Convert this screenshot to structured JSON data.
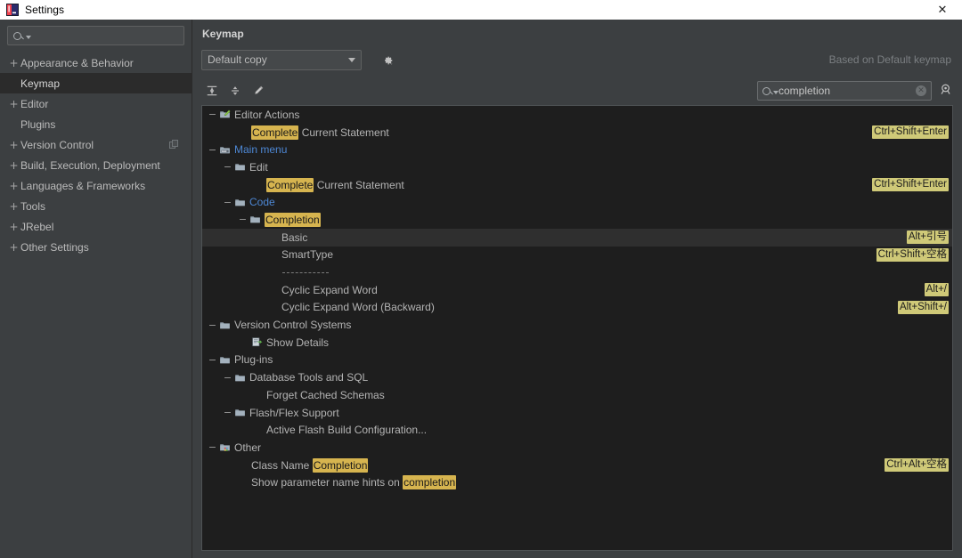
{
  "window": {
    "title": "Settings",
    "icon": "intellij-idea-icon",
    "close_label": "✕"
  },
  "sidebar": {
    "search": {
      "placeholder": "",
      "value": "",
      "icon": "search-icon"
    },
    "items": [
      {
        "label": "Appearance & Behavior",
        "expander": "+",
        "selected": false,
        "trailing_icon": ""
      },
      {
        "label": "Keymap",
        "expander": "",
        "selected": true,
        "trailing_icon": ""
      },
      {
        "label": "Editor",
        "expander": "+",
        "selected": false,
        "trailing_icon": ""
      },
      {
        "label": "Plugins",
        "expander": "",
        "selected": false,
        "trailing_icon": ""
      },
      {
        "label": "Version Control",
        "expander": "+",
        "selected": false,
        "trailing_icon": "copy-icon"
      },
      {
        "label": "Build, Execution, Deployment",
        "expander": "+",
        "selected": false,
        "trailing_icon": ""
      },
      {
        "label": "Languages & Frameworks",
        "expander": "+",
        "selected": false,
        "trailing_icon": ""
      },
      {
        "label": "Tools",
        "expander": "+",
        "selected": false,
        "trailing_icon": ""
      },
      {
        "label": "JRebel",
        "expander": "+",
        "selected": false,
        "trailing_icon": ""
      },
      {
        "label": "Other Settings",
        "expander": "+",
        "selected": false,
        "trailing_icon": ""
      }
    ]
  },
  "panel": {
    "title": "Keymap",
    "keymap_select": {
      "value": "Default copy",
      "icon": "chevron-down-icon"
    },
    "gear_label": "gear-icon",
    "based_on": "Based on Default keymap"
  },
  "toolbar": {
    "expand_all": "expand-all-icon",
    "collapse_all": "collapse-all-icon",
    "edit": "edit-pencil-icon",
    "search": {
      "value": "completion",
      "placeholder": "",
      "icon": "search-icon",
      "clear": "✕"
    },
    "find_by_shortcut": "find-by-shortcut-icon"
  },
  "tree": {
    "rows": [
      {
        "id": "editor-actions",
        "indent": 0,
        "expander": "−",
        "icon": "editor-actions-icon",
        "text": "Editor Actions",
        "link": false,
        "selected": false,
        "shortcut": ""
      },
      {
        "id": "complete-current-statement-1",
        "indent": "leaf-1",
        "expander": "",
        "icon": "",
        "text": "Complete Current Statement",
        "highlight": "Complete",
        "link": false,
        "selected": false,
        "shortcut": "Ctrl+Shift+Enter"
      },
      {
        "id": "main-menu",
        "indent": 0,
        "expander": "−",
        "icon": "main-menu-icon",
        "text": "Main menu",
        "link": true,
        "selected": false,
        "shortcut": ""
      },
      {
        "id": "edit",
        "indent": 1,
        "expander": "−",
        "icon": "folder-icon",
        "text": "Edit",
        "link": false,
        "selected": false,
        "shortcut": ""
      },
      {
        "id": "complete-current-statement-2",
        "indent": "leaf-2",
        "expander": "",
        "icon": "",
        "text": "Complete Current Statement",
        "highlight": "Complete",
        "link": false,
        "selected": false,
        "shortcut": "Ctrl+Shift+Enter"
      },
      {
        "id": "code",
        "indent": 1,
        "expander": "−",
        "icon": "folder-icon",
        "text": "Code",
        "link": true,
        "selected": false,
        "shortcut": ""
      },
      {
        "id": "completion-folder",
        "indent": 2,
        "expander": "−",
        "icon": "folder-icon",
        "text": "Completion",
        "highlight": "Completion",
        "link": false,
        "selected": false,
        "shortcut": ""
      },
      {
        "id": "basic",
        "indent": "leaf-3",
        "expander": "",
        "icon": "",
        "text": "Basic",
        "link": false,
        "selected": true,
        "shortcut": "Alt+引号"
      },
      {
        "id": "smarttype",
        "indent": "leaf-3",
        "expander": "",
        "icon": "",
        "text": "SmartType",
        "link": false,
        "selected": false,
        "shortcut": "Ctrl+Shift+空格"
      },
      {
        "id": "separator",
        "indent": "leaf-3",
        "separator": true
      },
      {
        "id": "cyclic-expand-word",
        "indent": "leaf-3",
        "expander": "",
        "icon": "",
        "text": "Cyclic Expand Word",
        "link": false,
        "selected": false,
        "shortcut": "Alt+/"
      },
      {
        "id": "cyclic-expand-word-backward",
        "indent": "leaf-3",
        "expander": "",
        "icon": "",
        "text": "Cyclic Expand Word (Backward)",
        "link": false,
        "selected": false,
        "shortcut": "Alt+Shift+/"
      },
      {
        "id": "version-control-systems",
        "indent": 0,
        "expander": "−",
        "icon": "folder-icon",
        "text": "Version Control Systems",
        "link": false,
        "selected": false,
        "shortcut": ""
      },
      {
        "id": "show-details",
        "indent": "leaf-1",
        "expander": "",
        "icon": "show-details-icon",
        "text": "Show Details",
        "link": false,
        "selected": false,
        "shortcut": ""
      },
      {
        "id": "plug-ins",
        "indent": 0,
        "expander": "−",
        "icon": "folder-icon",
        "text": "Plug-ins",
        "link": false,
        "selected": false,
        "shortcut": ""
      },
      {
        "id": "database-tools-and-sql",
        "indent": 1,
        "expander": "−",
        "icon": "folder-icon",
        "text": "Database Tools and SQL",
        "link": false,
        "selected": false,
        "shortcut": ""
      },
      {
        "id": "forget-cached-schemas",
        "indent": "leaf-2",
        "expander": "",
        "icon": "",
        "text": "Forget Cached Schemas",
        "link": false,
        "selected": false,
        "shortcut": ""
      },
      {
        "id": "flash-flex-support",
        "indent": 1,
        "expander": "−",
        "icon": "folder-icon",
        "text": "Flash/Flex Support",
        "link": false,
        "selected": false,
        "shortcut": ""
      },
      {
        "id": "active-flash-build-configuration",
        "indent": "leaf-2",
        "expander": "",
        "icon": "",
        "text": "Active Flash Build Configuration...",
        "link": false,
        "selected": false,
        "shortcut": ""
      },
      {
        "id": "other",
        "indent": 0,
        "expander": "−",
        "icon": "other-icon",
        "text": "Other",
        "link": false,
        "selected": false,
        "shortcut": ""
      },
      {
        "id": "class-name-completion",
        "indent": "leaf-1",
        "expander": "",
        "icon": "",
        "text": "Class Name Completion",
        "highlight": "Completion",
        "link": false,
        "selected": false,
        "shortcut": "Ctrl+Alt+空格"
      },
      {
        "id": "show-parameter-name-hints-on-completion",
        "indent": "leaf-1",
        "expander": "",
        "icon": "",
        "text": "Show parameter name hints on completion",
        "highlight": "completion",
        "link": false,
        "selected": false,
        "shortcut": ""
      }
    ]
  },
  "colors": {
    "background": "#3c3f41",
    "tree_background": "#1e1e1e",
    "highlight": "#d6b44f",
    "shortcut_badge": "#cfc978",
    "link": "#4d87d4",
    "selected_row": "#2f2f2f",
    "text": "#b4b4b4"
  }
}
